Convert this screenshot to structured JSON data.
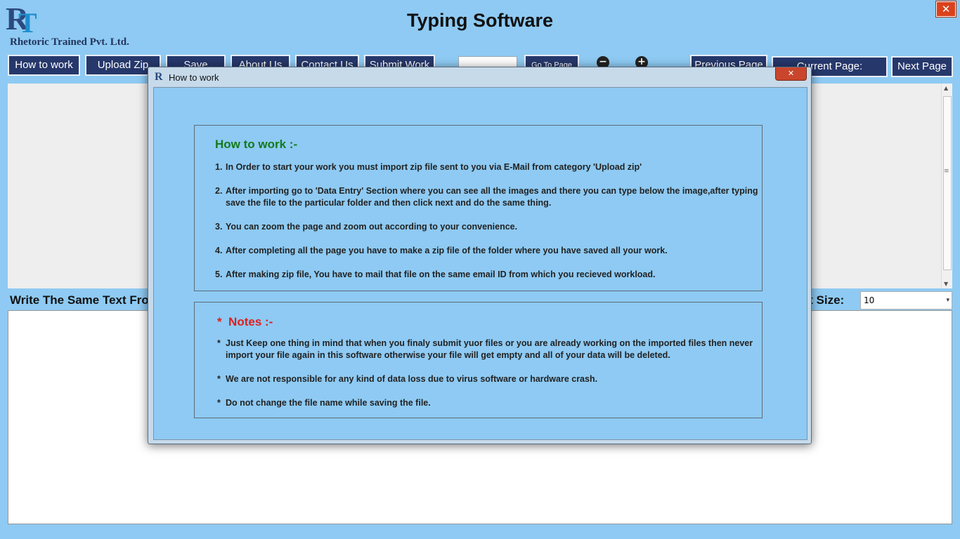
{
  "app": {
    "title": "Typing Software",
    "logo_mark": "R",
    "logo_mark_t": "T",
    "company": "Rhetoric Trained Pvt. Ltd.",
    "close_glyph": "✕"
  },
  "toolbar": {
    "how_to_work": "How to work",
    "upload_zip": "Upload Zip",
    "save": "Save",
    "about_us": "About Us",
    "contact_us": "Contact Us",
    "submit_work": "Submit Work",
    "page_input_value": "",
    "go_to_page": "Go To Page",
    "zoom_out": "−",
    "zoom_in": "+",
    "zoom_out_pct": "%",
    "zoom_in_pct": "%",
    "previous_page": "Previous Page",
    "current_page": "Current Page:",
    "next_page": "Next Page"
  },
  "editor": {
    "write_label": "Write The Same Text From",
    "font_size_label": "Font Size:",
    "font_size_value": "10",
    "dropdown_glyph": "▾",
    "scroll_up": "▲",
    "scroll_down": "▼",
    "scroll_grip": "≡"
  },
  "dialog": {
    "title": "How to work",
    "icon": "R",
    "close_glyph": "✕",
    "how_heading": "How to work :-",
    "steps": [
      {
        "num": "1.",
        "text": "In Order to start your work you must import zip file sent to you via E-Mail from category 'Upload zip'"
      },
      {
        "num": "2.",
        "text": "After importing go to 'Data Entry' Section where you can see all the images and there you can type below the image,after typing save the file to the particular folder and then click next and do the same thing."
      },
      {
        "num": "3.",
        "text": "You can zoom the page and zoom out according to your convenience."
      },
      {
        "num": "4.",
        "text": "After completing all the page you have to make a zip file of the folder where you have saved all your work."
      },
      {
        "num": "5.",
        "text": "After making zip file, You have to mail that file on the same email ID from which you recieved workload."
      }
    ],
    "notes_heading": "*  Notes :-",
    "notes": [
      {
        "bullet": "*",
        "text": "Just Keep one thing in mind that when you finaly submit yuor files or you are already working on the imported files then never import your file again in this software otherwise your file will get empty and all of your data will be deleted."
      },
      {
        "bullet": "*",
        "text": "We are not responsible for any kind of data loss due to virus software or hardware crash."
      },
      {
        "bullet": "*",
        "text": "Do not change the file name while saving the file."
      }
    ]
  }
}
